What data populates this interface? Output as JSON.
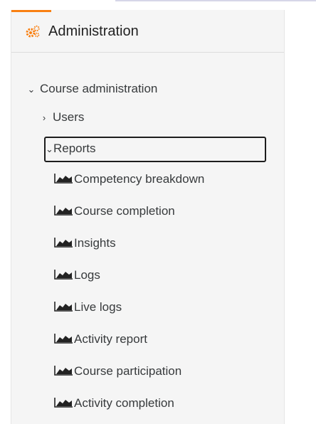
{
  "block": {
    "title": "Administration",
    "accent_color": "#f98012",
    "icon": "gears-icon"
  },
  "tree": {
    "course_admin": {
      "label": "Course administration",
      "state": "expanded"
    },
    "users": {
      "label": "Users",
      "state": "collapsed"
    },
    "reports": {
      "label": "Reports",
      "state": "expanded"
    },
    "report_items": [
      {
        "label": "Competency breakdown",
        "icon": "report-chart-icon"
      },
      {
        "label": "Course completion",
        "icon": "report-chart-icon"
      },
      {
        "label": "Insights",
        "icon": "report-chart-icon"
      },
      {
        "label": "Logs",
        "icon": "report-chart-icon"
      },
      {
        "label": "Live logs",
        "icon": "report-chart-icon"
      },
      {
        "label": "Activity report",
        "icon": "report-chart-icon"
      },
      {
        "label": "Course participation",
        "icon": "report-chart-icon"
      },
      {
        "label": "Activity completion",
        "icon": "report-chart-icon"
      }
    ]
  }
}
